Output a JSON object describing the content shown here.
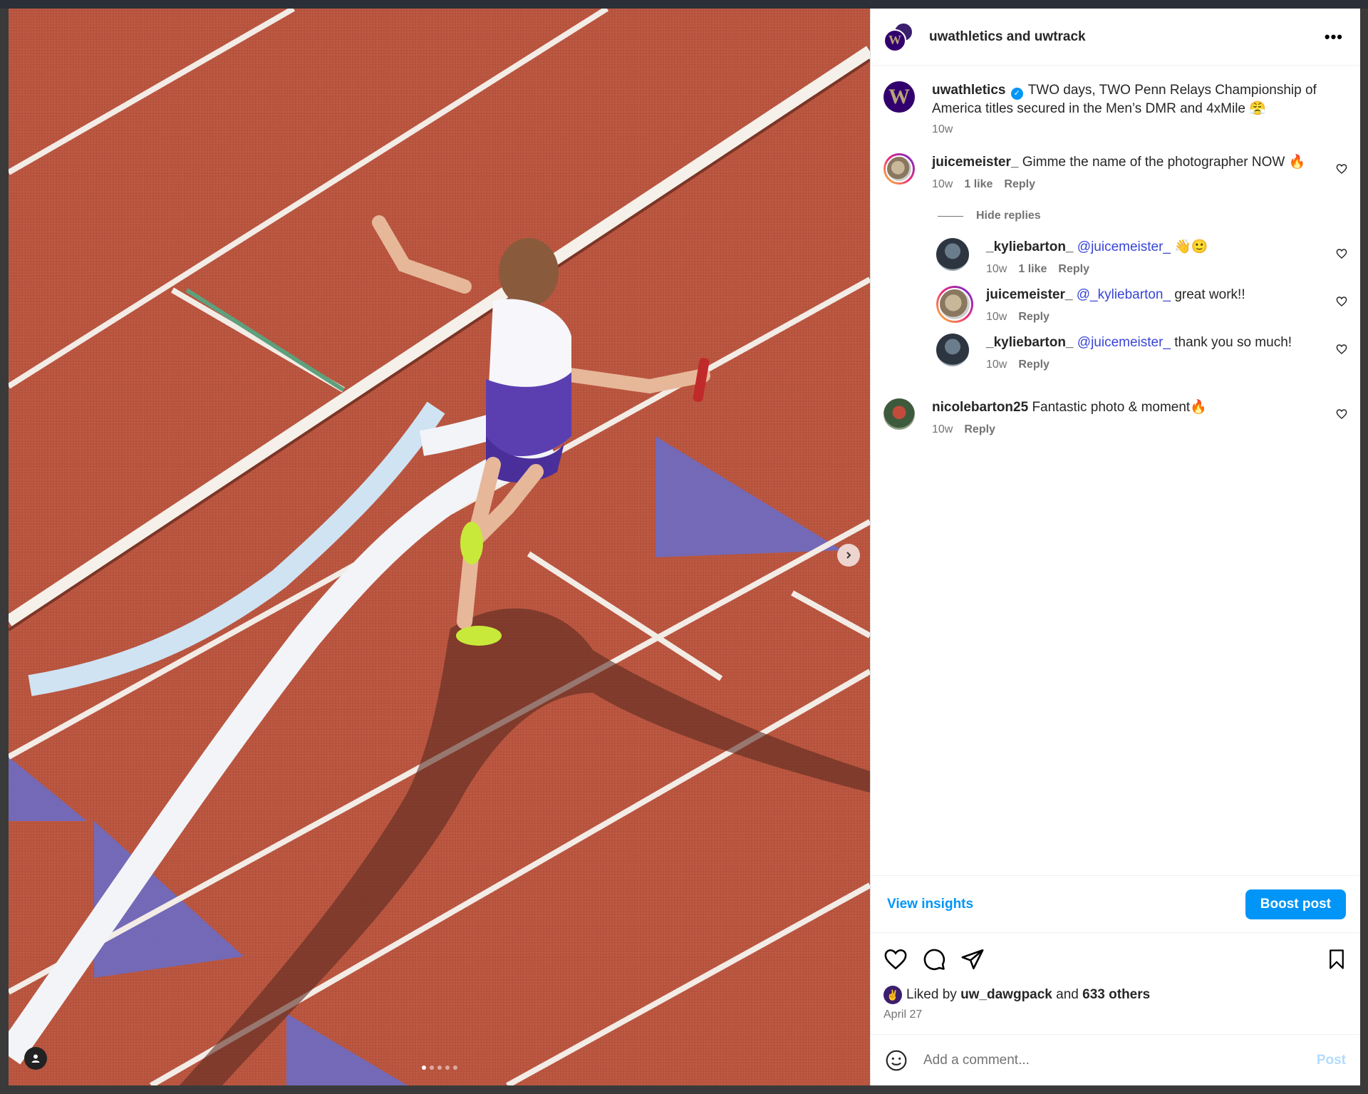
{
  "header": {
    "title": "uwathletics and uwtrack",
    "avatar_letter": "W"
  },
  "caption": {
    "username": "uwathletics",
    "text": "TWO days, TWO Penn Relays Championship of America titles secured in the Men’s DMR and 4xMile 😤",
    "time": "10w",
    "avatar_letter": "W"
  },
  "comments": [
    {
      "username": "juicemeister_",
      "text": "Gimme the name of the photographer NOW 🔥",
      "time": "10w",
      "likes": "1 like",
      "reply_label": "Reply"
    },
    {
      "username": "nicolebarton25",
      "text": "Fantastic photo & moment🔥",
      "time": "10w",
      "reply_label": "Reply"
    }
  ],
  "hide_replies_label": "Hide replies",
  "replies": [
    {
      "username": "_kyliebarton_",
      "mention": "@juicemeister_",
      "text": " 👋🙂",
      "time": "10w",
      "likes": "1 like",
      "reply_label": "Reply"
    },
    {
      "username": "juicemeister_",
      "mention": "@_kyliebarton_",
      "text": " great work!!",
      "time": "10w",
      "reply_label": "Reply"
    },
    {
      "username": "_kyliebarton_",
      "mention": "@juicemeister_",
      "text": " thank you so much!",
      "time": "10w",
      "reply_label": "Reply"
    }
  ],
  "insights": {
    "view_label": "View insights",
    "boost_label": "Boost post"
  },
  "likes": {
    "prefix": "Liked by",
    "user": "uw_dawgpack",
    "joiner": "and",
    "others": "633 others"
  },
  "date": "April 27",
  "add_comment": {
    "placeholder": "Add a comment...",
    "post_label": "Post"
  },
  "colors": {
    "accent": "#0095f6",
    "mention": "#3845d6",
    "track": "#b9553f",
    "lane_purple": "#6b6bc4"
  },
  "carousel": {
    "count": 5,
    "active": 1
  }
}
